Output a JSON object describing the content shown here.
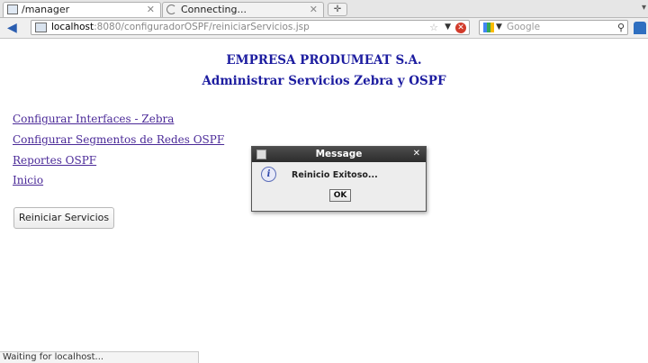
{
  "browser": {
    "tabs": [
      {
        "title": "/manager",
        "active": true
      },
      {
        "title": "Connecting...",
        "active": false
      }
    ],
    "url": {
      "host": "localhost",
      "path": ":8080/configuradorOSPF/reiniciarServicios.jsp"
    },
    "search_placeholder": "Google",
    "status_text": "Waiting for localhost..."
  },
  "page": {
    "company": "EMPRESA PRODUMEAT S.A.",
    "subtitle": "Administrar Servicios Zebra y OSPF",
    "links": [
      "Configurar Interfaces - Zebra",
      "Configurar Segmentos de Redes OSPF",
      "Reportes OSPF",
      "Inicio"
    ],
    "restart_button": "Reiniciar Servicios"
  },
  "dialog": {
    "title": "Message",
    "message": "Reinicio Exitoso...",
    "ok": "OK"
  },
  "colors": {
    "heading": "#1d1da0",
    "link": "#4b2a98",
    "dialog_title_bg": "#3a3a3a"
  }
}
